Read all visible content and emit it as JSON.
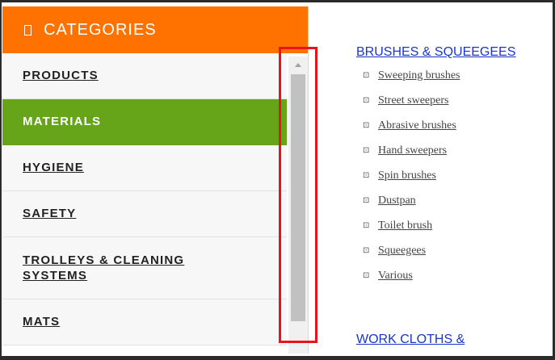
{
  "sidebar": {
    "header": {
      "icon": "square-icon",
      "glyph": "",
      "title": "CATEGORIES",
      "color": "#ff7200"
    },
    "items": [
      {
        "label": "PRODUCTS"
      },
      {
        "label": "MATERIALS",
        "active": true
      },
      {
        "label": "HYGIENE"
      },
      {
        "label": "SAFETY"
      },
      {
        "label": "TROLLEYS & CLEANING SYSTEMS"
      },
      {
        "label": "MATS"
      }
    ],
    "active_color": "#66a519"
  },
  "content": {
    "section1": {
      "title": "BRUSHES & SQUEEGEES",
      "items": [
        "Sweeping brushes",
        "Street sweepers",
        "Abrasive brushes",
        "Hand sweepers",
        "Spin brushes",
        "Dustpan",
        "Toilet brush",
        "Squeegees",
        "Various"
      ]
    },
    "section2": {
      "title": "WORK CLOTHS &"
    },
    "bullet_glyph": "⊡"
  },
  "annotation": {
    "color": "#e8141b"
  }
}
